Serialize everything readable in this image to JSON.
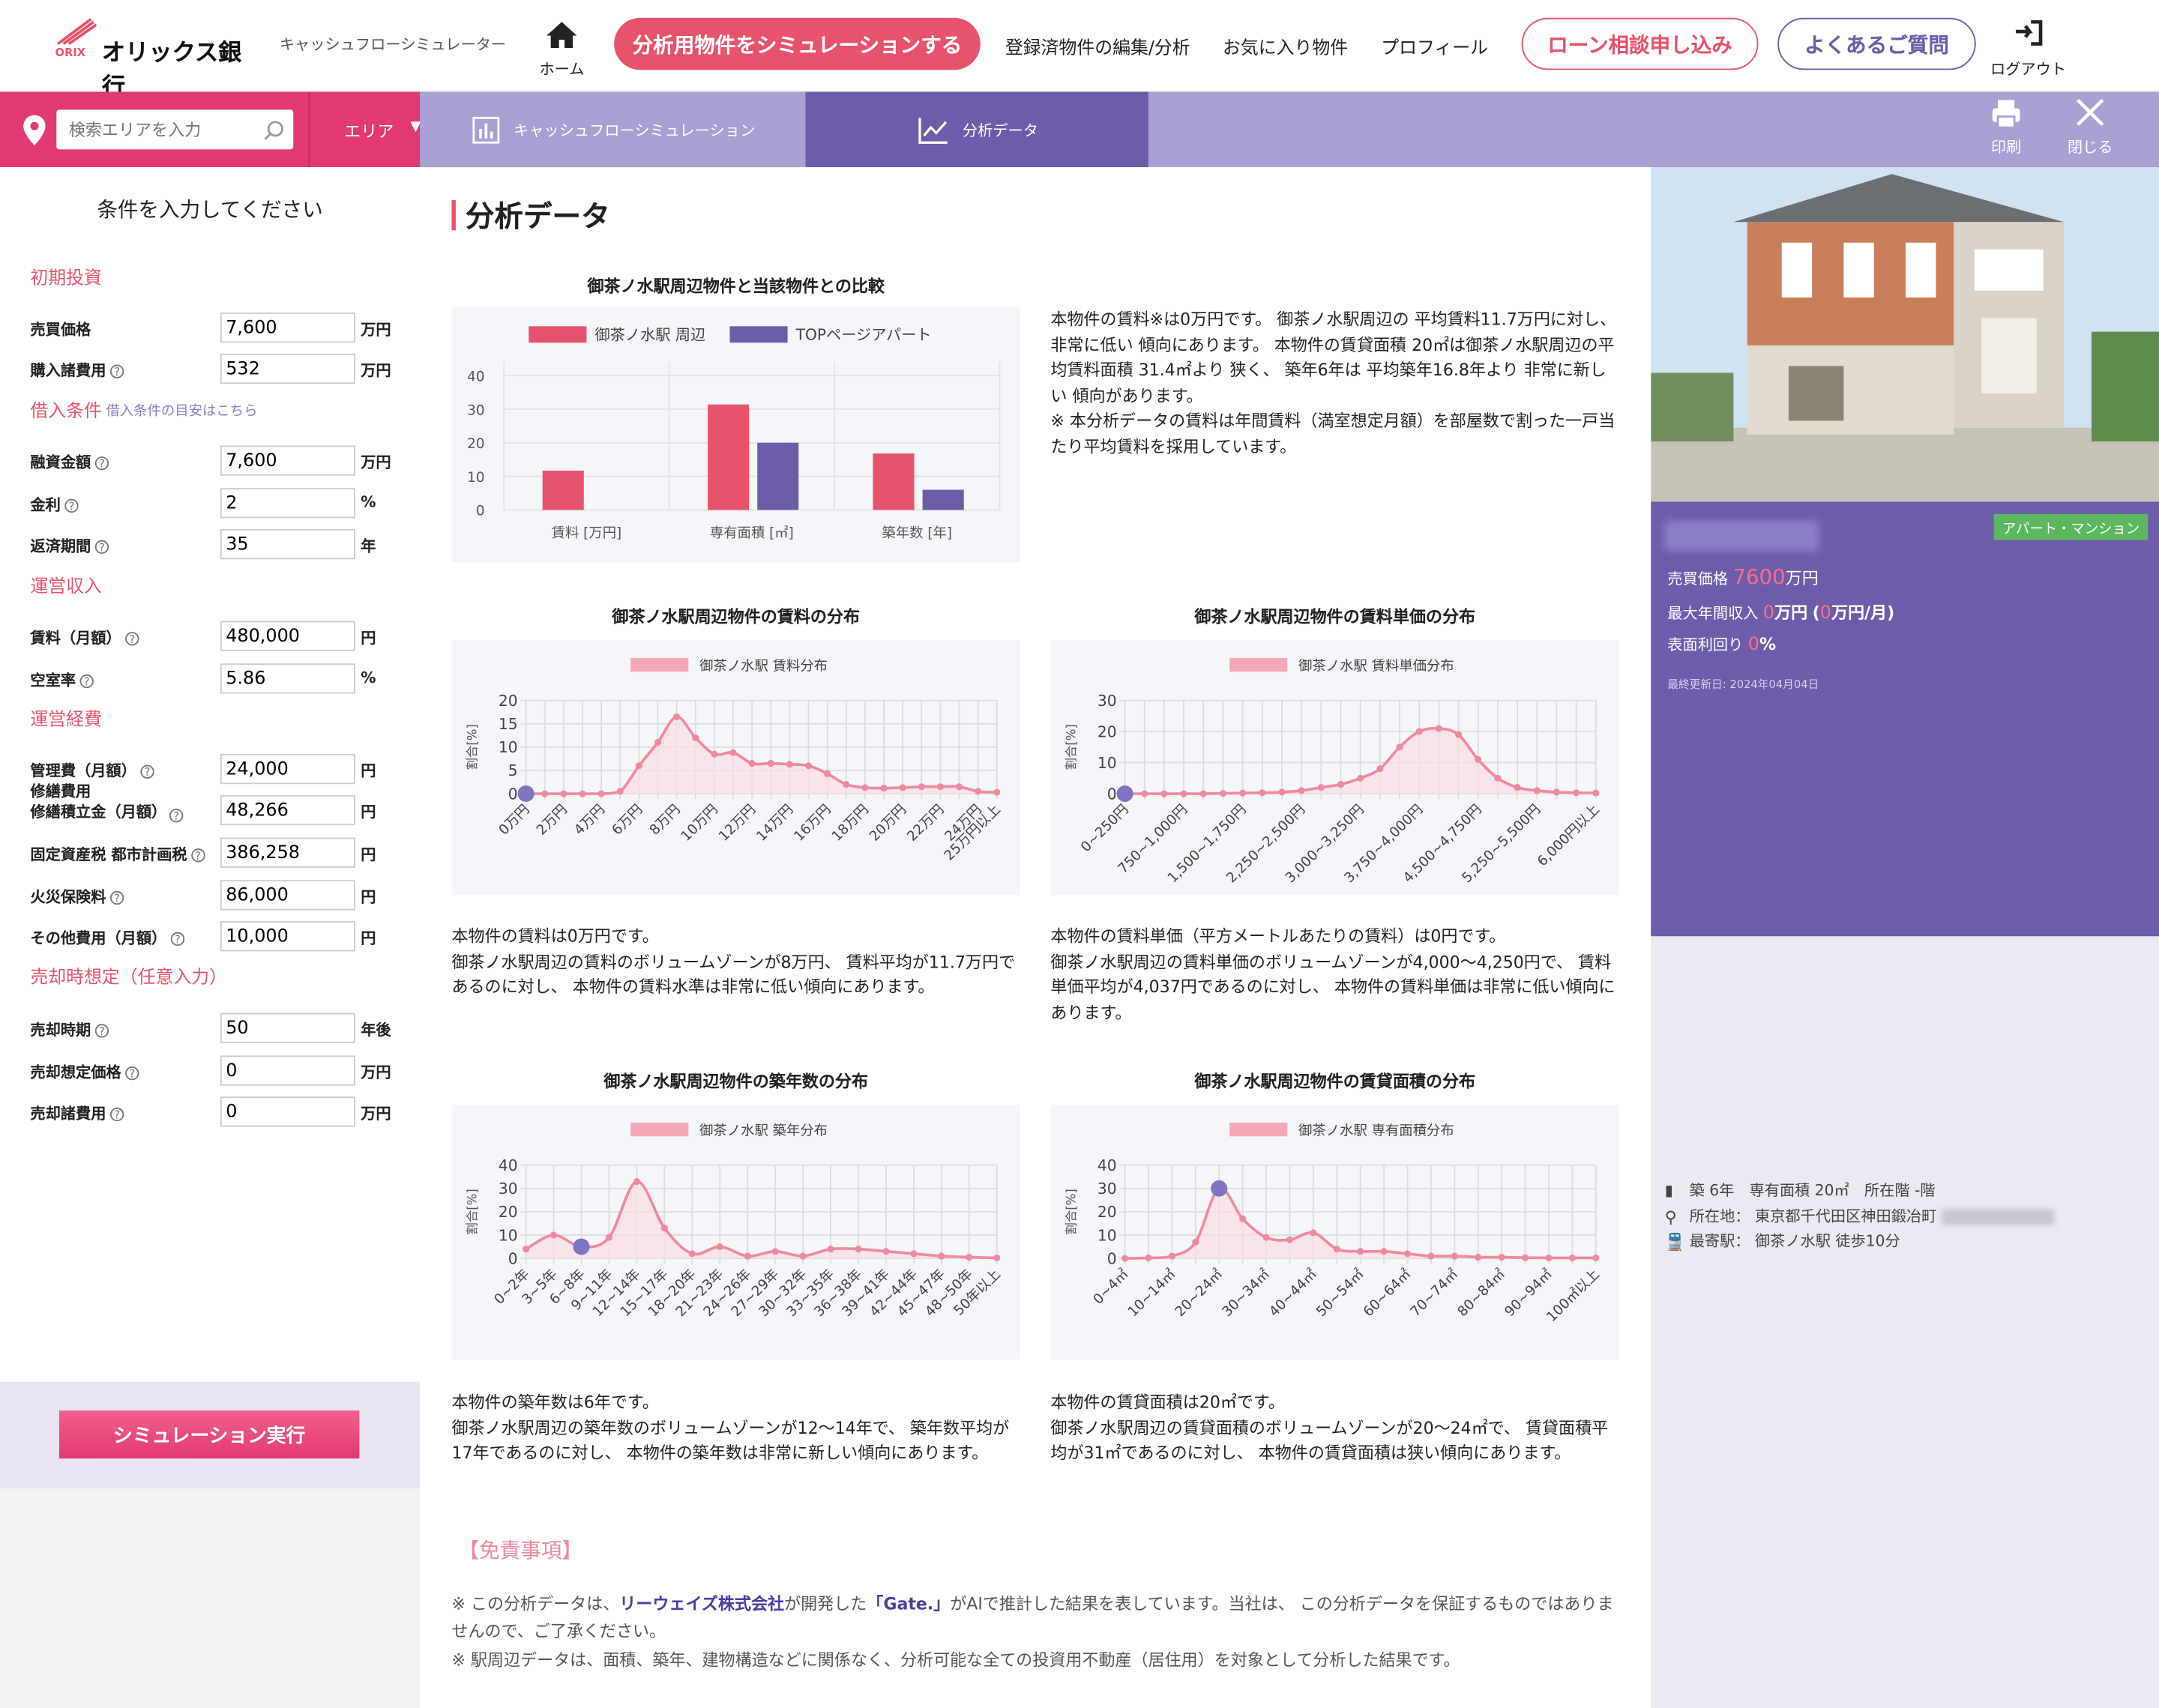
{
  "header": {
    "brand": "オリックス銀行",
    "brand_sub": "ORIX",
    "app_name": "キャッシュフローシミュレーター",
    "home_label": "ホーム",
    "simulate_button": "分析用物件をシミュレーションする",
    "nav_items": [
      "登録済物件の編集/分析",
      "お気に入り物件",
      "プロフィール"
    ],
    "loan_button": "ローン相談申し込み",
    "faq_button": "よくあるご質問",
    "logout_label": "ログアウト"
  },
  "tabbar": {
    "search_placeholder": "検索エリアを入力",
    "area_label": "エリア",
    "tab_cashflow": "キャッシュフローシミュレーション",
    "tab_analysis": "分析データ",
    "print_label": "印刷",
    "close_label": "閉じる"
  },
  "sidebar": {
    "title": "条件を入力してください",
    "sections": {
      "initial": "初期投資",
      "loan": "借入条件",
      "loan_hint": "借入条件の目安はこちら",
      "income": "運営収入",
      "expense": "運営経費",
      "sale": "売却時想定（任意入力）"
    },
    "fields": [
      {
        "label": "売買価格",
        "value": "7,600",
        "unit": "万円",
        "help": false
      },
      {
        "label": "購入諸費用",
        "value": "532",
        "unit": "万円",
        "help": true
      },
      {
        "label": "融資金額",
        "value": "7,600",
        "unit": "万円",
        "help": true
      },
      {
        "label": "金利",
        "value": "2",
        "unit": "%",
        "help": true
      },
      {
        "label": "返済期間",
        "value": "35",
        "unit": "年",
        "help": true
      },
      {
        "label": "賃料（月額）",
        "value": "480,000",
        "unit": "円",
        "help": true
      },
      {
        "label": "空室率",
        "value": "5.86",
        "unit": "%",
        "help": true
      },
      {
        "label": "管理費（月額）",
        "value": "24,000",
        "unit": "円",
        "help": true
      },
      {
        "label": "修繕費用",
        "label2": "修繕積立金（月額）",
        "value": "48,266",
        "unit": "円",
        "help": true
      },
      {
        "label": "固定資産税 都市計画税",
        "value": "386,258",
        "unit": "円",
        "help": true
      },
      {
        "label": "火災保険料",
        "value": "86,000",
        "unit": "円",
        "help": true
      },
      {
        "label": "その他費用（月額）",
        "value": "10,000",
        "unit": "円",
        "help": true
      },
      {
        "label": "売却時期",
        "value": "50",
        "unit": "年後",
        "help": true
      },
      {
        "label": "売却想定価格",
        "value": "0",
        "unit": "万円",
        "help": true
      },
      {
        "label": "売却諸費用",
        "value": "0",
        "unit": "万円",
        "help": true
      }
    ],
    "run_button": "シミュレーション実行"
  },
  "main": {
    "heading": "分析データ",
    "compare_title": "御茶ノ水駅周辺物件と当該物件との比較",
    "compare_text": "本物件の賃料※は0万円です。 御茶ノ水駅周辺の 平均賃料11.7万円に対し、 非常に低い 傾向にあります。 本物件の賃貸面積 20㎡は御茶ノ水駅周辺の平均賃料面積 31.4㎡より 狭く、 築年6年は 平均築年16.8年より 非常に新しい 傾向があります。\n※ 本分析データの賃料は年間賃料（満室想定月額）を部屋数で割った一戸当たり平均賃料を採用しています。",
    "rent_title": "御茶ノ水駅周辺物件の賃料の分布",
    "rent_text": "本物件の賃料は0万円です。\n御茶ノ水駅周辺の賃料のボリュームゾーンが8万円、 賃料平均が11.7万円であるのに対し、 本物件の賃料水準は非常に低い傾向にあります。",
    "unit_title": "御茶ノ水駅周辺物件の賃料単価の分布",
    "unit_text": "本物件の賃料単価（平方メートルあたりの賃料）は0円です。\n御茶ノ水駅周辺の賃料単価のボリュームゾーンが4,000〜4,250円で、 賃料単価平均が4,037円であるのに対し、 本物件の賃料単価は非常に低い傾向にあります。",
    "age_title": "御茶ノ水駅周辺物件の築年数の分布",
    "age_text": "本物件の築年数は6年です。\n御茶ノ水駅周辺の築年数のボリュームゾーンが12〜14年で、 築年数平均が17年であるのに対し、 本物件の築年数は非常に新しい傾向にあります。",
    "area_title": "御茶ノ水駅周辺物件の賃貸面積の分布",
    "area_text": "本物件の賃貸面積は20㎡です。\n御茶ノ水駅周辺の賃貸面積のボリュームゾーンが20〜24㎡で、 賃貸面積平均が31㎡であるのに対し、 本物件の賃貸面積は狭い傾向にあります。",
    "disclaimer_title": "【免責事項】",
    "disclaimer_1a": "※ この分析データは、",
    "disclaimer_1b": "リーウェイズ株式会社",
    "disclaimer_1c": "が開発した",
    "disclaimer_1d": "「Gate.」",
    "disclaimer_1e": "がAIで推計した結果を表しています。当社は、 この分析データを保証するものではありませんので、ご了承ください。",
    "disclaimer_2": "※ 駅周辺データは、面積、築年、建物構造などに関係なく、分析可能な全ての投資用不動産（居住用）を対象として分析した結果です。"
  },
  "property": {
    "type_badge": "アパート・マンション",
    "price_label": "売買価格",
    "price_value": "7600",
    "price_unit": "万円",
    "income_label": "最大年間収入",
    "income_value": "0",
    "income_unit": "万円",
    "income_monthly_open": "(",
    "income_monthly": "0",
    "income_monthly_unit": "万円/月)",
    "yield_label": "表面利回り",
    "yield_value": "0",
    "yield_unit": "%",
    "updated": "最終更新日: 2024年04月04日",
    "info_age": "築 6年　専有面積 20㎡　所在階 -階",
    "info_address": "所在地： 東京都千代田区神田鍛冶町",
    "info_station": "最寄駅： 御茶ノ水駅 徒歩10分"
  },
  "colors": {
    "pink": "#e8536c",
    "purple": "#6c5caa",
    "tab": "#a9a1d3",
    "line": "#f0899d"
  },
  "chart_data": [
    {
      "type": "bar",
      "title": "御茶ノ水駅周辺物件と当該物件との比較",
      "categories": [
        "賃料 [万円]",
        "専有面積 [㎡]",
        "築年数 [年]"
      ],
      "series": [
        {
          "name": "御茶ノ水駅 周辺",
          "values": [
            11.7,
            31.4,
            16.8
          ],
          "color": "#e8536c"
        },
        {
          "name": "TOPページアパート",
          "values": [
            0,
            20,
            6
          ],
          "color": "#6c5caa"
        }
      ],
      "ylim": [
        0,
        40
      ],
      "yticks": [
        0,
        10,
        20,
        30,
        40
      ]
    },
    {
      "type": "line",
      "title": "御茶ノ水駅周辺物件の賃料の分布",
      "series_name": "御茶ノ水駅 賃料分布",
      "ylabel": "割合[%]",
      "ylim": [
        0,
        20
      ],
      "yticks": [
        0,
        5,
        10,
        15,
        20
      ],
      "x": [
        "0万円",
        "1万円",
        "2万円",
        "3万円",
        "4万円",
        "5万円",
        "6万円",
        "7万円",
        "8万円",
        "9万円",
        "10万円",
        "11万円",
        "12万円",
        "13万円",
        "14万円",
        "15万円",
        "16万円",
        "17万円",
        "18万円",
        "19万円",
        "20万円",
        "21万円",
        "22万円",
        "23万円",
        "24万円",
        "25万円以上"
      ],
      "xticks": [
        "0万円",
        "2万円",
        "4万円",
        "6万円",
        "8万円",
        "10万円",
        "12万円",
        "14万円",
        "16万円",
        "18万円",
        "20万円",
        "22万円",
        "24万円",
        "25万円以上"
      ],
      "values": [
        0,
        0,
        0,
        0,
        0,
        0.5,
        6,
        11,
        16.5,
        12,
        8.5,
        8.8,
        6.5,
        6.5,
        6.3,
        6,
        4.3,
        2,
        1.3,
        1.2,
        1.3,
        1.5,
        1.5,
        1.5,
        0.5,
        0.3
      ],
      "marker_index": 0
    },
    {
      "type": "line",
      "title": "御茶ノ水駅周辺物件の賃料単価の分布",
      "series_name": "御茶ノ水駅 賃料単価分布",
      "ylabel": "割合[%]",
      "ylim": [
        0,
        30
      ],
      "yticks": [
        0,
        10,
        20,
        30
      ],
      "x": [
        "0~250円",
        "250~500円",
        "500~750円",
        "750~1,000円",
        "1,000~1,250円",
        "1,250~1,500円",
        "1,500~1,750円",
        "1,750~2,000円",
        "2,000~2,250円",
        "2,250~2,500円",
        "2,500~2,750円",
        "2,750~3,000円",
        "3,000~3,250円",
        "3,250~3,500円",
        "3,500~3,750円",
        "3,750~4,000円",
        "4,000~4,250円",
        "4,250~4,500円",
        "4,500~4,750円",
        "4,750~5,000円",
        "5,000~5,250円",
        "5,250~5,500円",
        "5,500~5,750円",
        "5,750~6,000円",
        "6,000円以上"
      ],
      "xticks": [
        "0~250円",
        "750~1,000円",
        "1,500~1,750円",
        "2,250~2,500円",
        "3,000~3,250円",
        "3,750~4,000円",
        "4,500~4,750円",
        "5,250~5,500円",
        "6,000円以上"
      ],
      "values": [
        0,
        0,
        0,
        0,
        0,
        0.1,
        0.2,
        0.3,
        0.5,
        1,
        2,
        3,
        5,
        8,
        15,
        20,
        21,
        19,
        11,
        5,
        2,
        1,
        0.5,
        0.3,
        0.2
      ],
      "marker_index": 0
    },
    {
      "type": "line",
      "title": "御茶ノ水駅周辺物件の築年数の分布",
      "series_name": "御茶ノ水駅 築年分布",
      "ylabel": "割合[%]",
      "ylim": [
        0,
        40
      ],
      "yticks": [
        0,
        10,
        20,
        30,
        40
      ],
      "x": [
        "0~2年",
        "3~5年",
        "6~8年",
        "9~11年",
        "12~14年",
        "15~17年",
        "18~20年",
        "21~23年",
        "24~26年",
        "27~29年",
        "30~32年",
        "33~35年",
        "36~38年",
        "39~41年",
        "42~44年",
        "45~47年",
        "48~50年",
        "50年以上"
      ],
      "xticks": [
        "0~2年",
        "3~5年",
        "6~8年",
        "9~11年",
        "12~14年",
        "15~17年",
        "18~20年",
        "21~23年",
        "24~26年",
        "27~29年",
        "30~32年",
        "33~35年",
        "36~38年",
        "39~41年",
        "42~44年",
        "45~47年",
        "48~50年",
        "50年以上"
      ],
      "values": [
        4,
        10,
        5,
        9,
        33,
        13,
        2,
        5,
        1,
        3,
        1,
        4,
        4,
        3,
        2,
        1,
        0.5,
        0.2
      ],
      "marker_index": 2
    },
    {
      "type": "line",
      "title": "御茶ノ水駅周辺物件の賃貸面積の分布",
      "series_name": "御茶ノ水駅 専有面積分布",
      "ylabel": "割合[%]",
      "ylim": [
        0,
        40
      ],
      "yticks": [
        0,
        10,
        20,
        30,
        40
      ],
      "x": [
        "0~4㎡",
        "5~9㎡",
        "10~14㎡",
        "15~19㎡",
        "20~24㎡",
        "25~29㎡",
        "30~34㎡",
        "35~39㎡",
        "40~44㎡",
        "45~49㎡",
        "50~54㎡",
        "55~59㎡",
        "60~64㎡",
        "65~69㎡",
        "70~74㎡",
        "75~79㎡",
        "80~84㎡",
        "85~89㎡",
        "90~94㎡",
        "95~99㎡",
        "100㎡以上"
      ],
      "xticks": [
        "0~4㎡",
        "10~14㎡",
        "20~24㎡",
        "30~34㎡",
        "40~44㎡",
        "50~54㎡",
        "60~64㎡",
        "70~74㎡",
        "80~84㎡",
        "90~94㎡",
        "100㎡以上"
      ],
      "values": [
        0,
        0.2,
        1,
        7,
        30,
        17,
        9,
        8,
        11,
        4,
        3,
        3,
        2,
        1,
        1,
        0.5,
        0.5,
        0.3,
        0.2,
        0.2,
        0.2
      ],
      "marker_index": 4
    }
  ]
}
